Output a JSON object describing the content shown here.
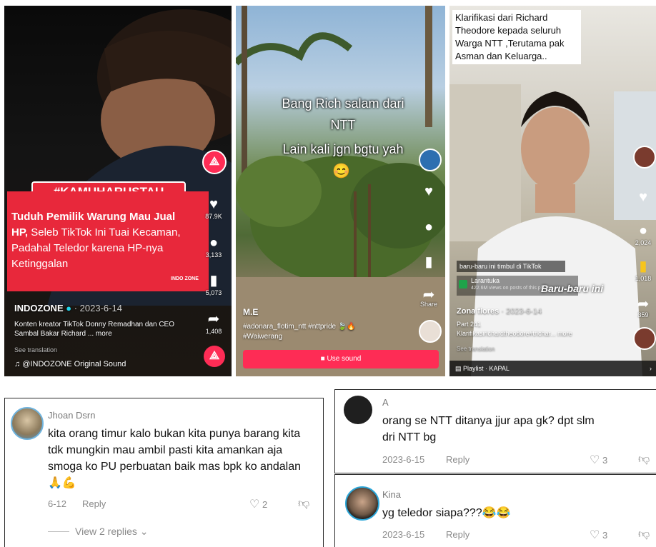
{
  "video1": {
    "hashtag": "#KAMUHARUSTAU",
    "headline_bold": "Tuduh Pemilik Warung Mau Jual HP,",
    "headline_rest": " Seleb TikTok Ini Tuai Kecaman, Padahal Teledor karena HP-nya Ketinggalan",
    "logo": "INDO ZONE",
    "likes": "87.9K",
    "comments": "3,133",
    "saves": "5,073",
    "shares": "1,408",
    "account": "INDOZONE",
    "date": "· 2023-6-14",
    "caption": "Konten kreator TikTok Donny Remadhan dan CEO Sambal Bakar Richard ... more",
    "translation": "See translation",
    "sound": "♫ @INDOZONE Original Sound"
  },
  "video2": {
    "overlay_line1": "Bang Rich salam dari",
    "overlay_line2": "NTT",
    "overlay_line3": "Lain kali jgn bgtu yah",
    "emoji": "😊",
    "account": "M.E",
    "tags": "#adonara_flotim_ntt #nttpride 🍃🔥",
    "tags2": "#Waiwerang",
    "share_label": "Share",
    "button": "Use sound"
  },
  "video3": {
    "overlay": "Klarifikasi dari Richard Theodore kepada seluruh Warga NTT ,Terutama pak Asman dan Keluarga..",
    "comments": "2,024",
    "saves": "1,018",
    "shares": "359",
    "banner": "baru-baru ini timbul di TikTok",
    "location": "Larantuka",
    "location_sub": "422.6M views on posts of this place",
    "sticker": "Baru-baru ini",
    "account": "Zona flores",
    "date": "· 2023-6-14",
    "part": "Part 241",
    "caption": "Klarifikasirichardtheodore#trichar... more",
    "translation": "See translation",
    "playlist": "Playlist · KAPAL"
  },
  "comment1": {
    "name": "Jhoan Dsrn",
    "text": "kita orang timur kalo bukan kita punya barang kita tdk mungkin mau ambil pasti kita amankan aja smoga ko PU perbuatan baik mas bpk ko andalan🙏💪",
    "date": "6-12",
    "reply": "Reply",
    "likes": "2",
    "view_replies": "View 2 replies"
  },
  "comment2": {
    "name": "A",
    "text": "orang se NTT ditanya jjur apa gk? dpt slm dri NTT bg",
    "date": "2023-6-15",
    "reply": "Reply",
    "likes": "3"
  },
  "comment3": {
    "name": "Kina",
    "text": "yg teledor siapa???😂😂",
    "date": "2023-6-15",
    "reply": "Reply",
    "likes": "3"
  },
  "colors": {
    "tiktok_red": "#fe2c55",
    "banner_red": "#e8283b"
  },
  "icons": [
    "heart-icon",
    "comment-icon",
    "bookmark-icon",
    "share-icon",
    "dislike-icon",
    "chevron-down-icon",
    "verified-icon",
    "music-icon",
    "playlist-icon",
    "location-icon",
    "camera-icon"
  ]
}
